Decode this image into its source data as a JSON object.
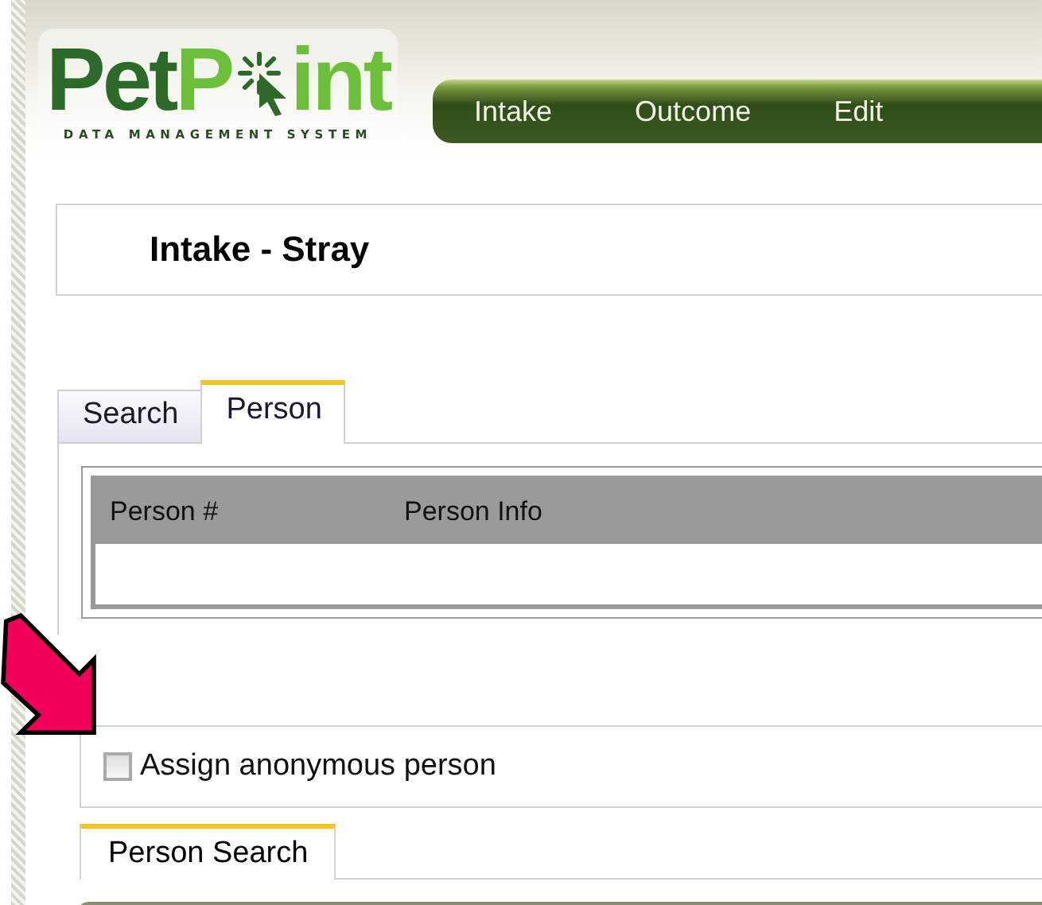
{
  "logo": {
    "part_1": "Pet",
    "part_2": "P",
    "part_3": "int",
    "tagline": "DATA MANAGEMENT SYSTEM"
  },
  "nav": [
    {
      "label": "Intake"
    },
    {
      "label": "Outcome"
    },
    {
      "label": "Edit"
    }
  ],
  "page_title": "Intake - Stray",
  "tabs": [
    {
      "label": "Search",
      "selected": false
    },
    {
      "label": "Person",
      "selected": true
    }
  ],
  "table": {
    "columns": [
      "Person #",
      "Person Info"
    ]
  },
  "anonymous": {
    "label": "Assign anonymous person",
    "checked": false
  },
  "sub_tabs": [
    {
      "label": "Person Search",
      "selected": true
    }
  ]
}
